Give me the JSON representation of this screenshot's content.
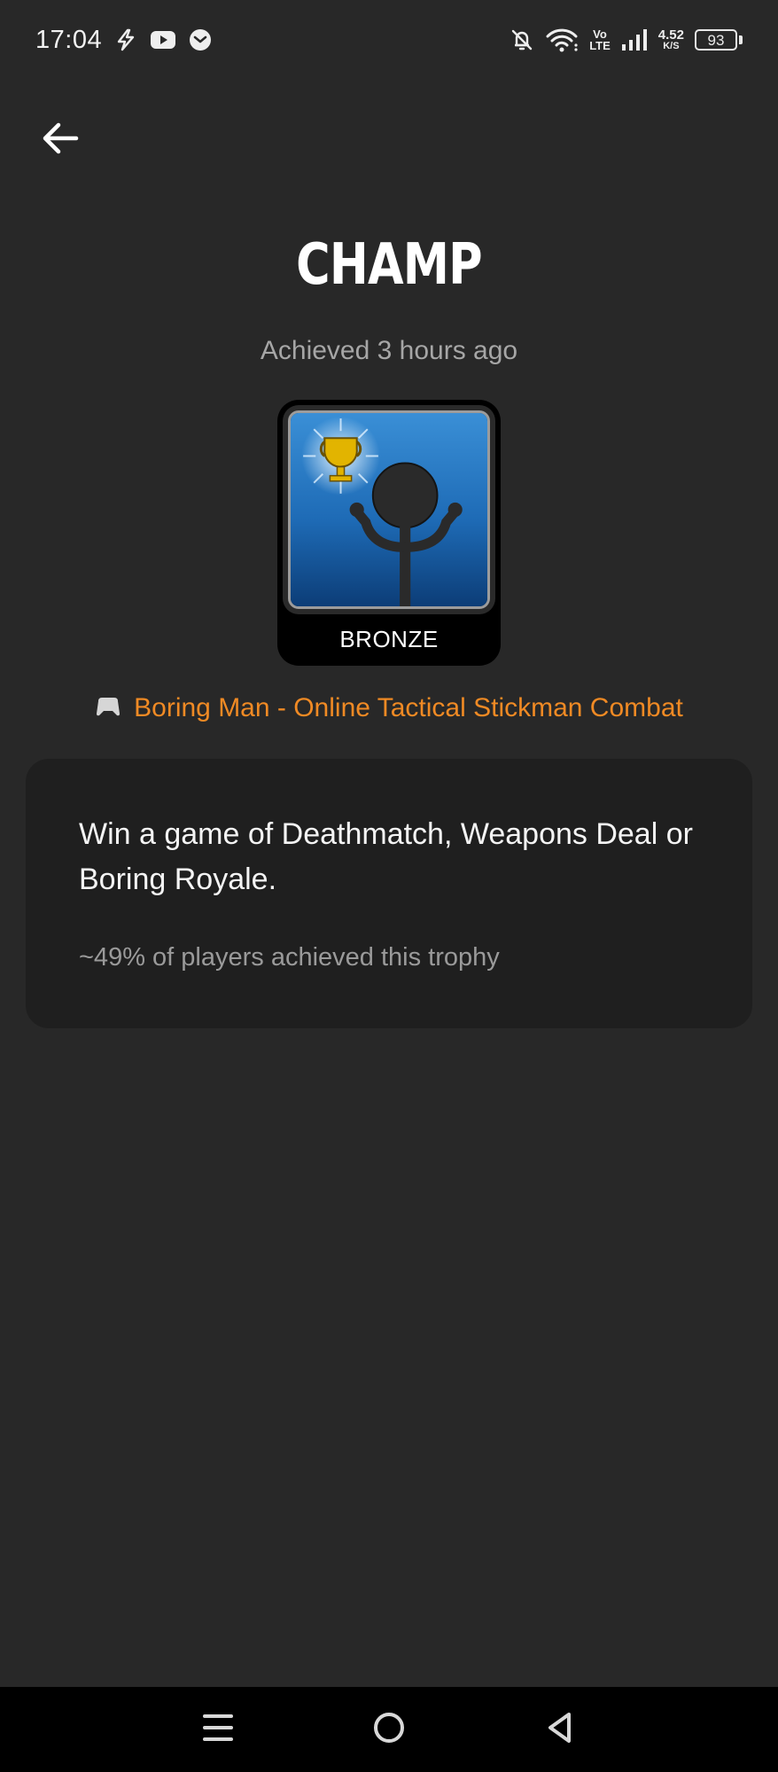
{
  "status_bar": {
    "time": "17:04",
    "network_speed_value": "4.52",
    "network_speed_unit": "K/S",
    "volte_top": "Vo",
    "volte_bottom": "LTE",
    "battery": "93",
    "icons": [
      "bolt-icon",
      "youtube-icon",
      "message-icon",
      "bell-off-icon",
      "wifi-icon",
      "signal-icon",
      "battery-icon"
    ]
  },
  "header": {
    "back_icon": "arrow-left-icon",
    "title": "CHAMP",
    "achieved": "Achieved 3 hours ago"
  },
  "trophy": {
    "tier": "BRONZE",
    "art": "stickman-trophy-image"
  },
  "game": {
    "icon": "gamepad-icon",
    "name": "Boring Man - Online Tactical Stickman Combat",
    "accent_color": "#f08a24"
  },
  "description": {
    "text": "Win a game of Deathmatch, Weapons Deal or Boring Royale.",
    "rarity": "~49% of players achieved this trophy"
  },
  "nav": {
    "items": [
      "menu-icon",
      "home-icon",
      "back-triangle-icon"
    ]
  }
}
